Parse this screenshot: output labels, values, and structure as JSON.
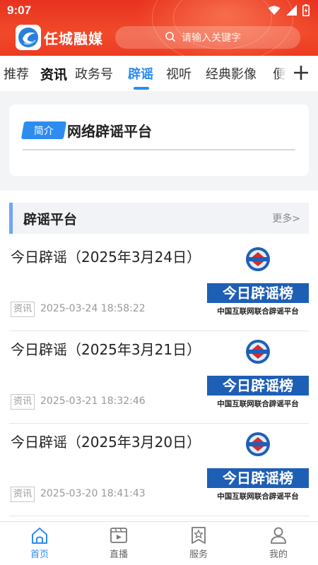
{
  "status": {
    "time": "9:07"
  },
  "header": {
    "app_name": "任城融媒",
    "search_placeholder": "请输入关键字"
  },
  "tabs": [
    {
      "label": "推荐"
    },
    {
      "label": "资讯"
    },
    {
      "label": "政务号"
    },
    {
      "label": "辟谣"
    },
    {
      "label": "视听"
    },
    {
      "label": "经典影像"
    },
    {
      "label": "便"
    }
  ],
  "intro": {
    "badge": "简介",
    "title": "网络辟谣平台"
  },
  "section": {
    "title": "辟谣平台",
    "more": "更多>"
  },
  "thumbnail": {
    "banner": "今日辟谣榜",
    "caption": "中国互联网联合辟谣平台"
  },
  "items": [
    {
      "title": "今日辟谣（2025年3月24日）",
      "tag": "资讯",
      "time": "2025-03-24 18:58:22"
    },
    {
      "title": "今日辟谣（2025年3月21日）",
      "tag": "资讯",
      "time": "2025-03-21 18:32:46"
    },
    {
      "title": "今日辟谣（2025年3月20日）",
      "tag": "资讯",
      "time": "2025-03-20 18:41:43"
    }
  ],
  "nav": [
    {
      "label": "首页",
      "icon": "home-icon",
      "active": true
    },
    {
      "label": "直播",
      "icon": "live-icon"
    },
    {
      "label": "服务",
      "icon": "service-icon"
    },
    {
      "label": "我的",
      "icon": "profile-icon"
    }
  ],
  "colors": {
    "accent": "#2d8cf0",
    "header_red": "#e8321f",
    "section_bar": "#6fa6f5"
  }
}
